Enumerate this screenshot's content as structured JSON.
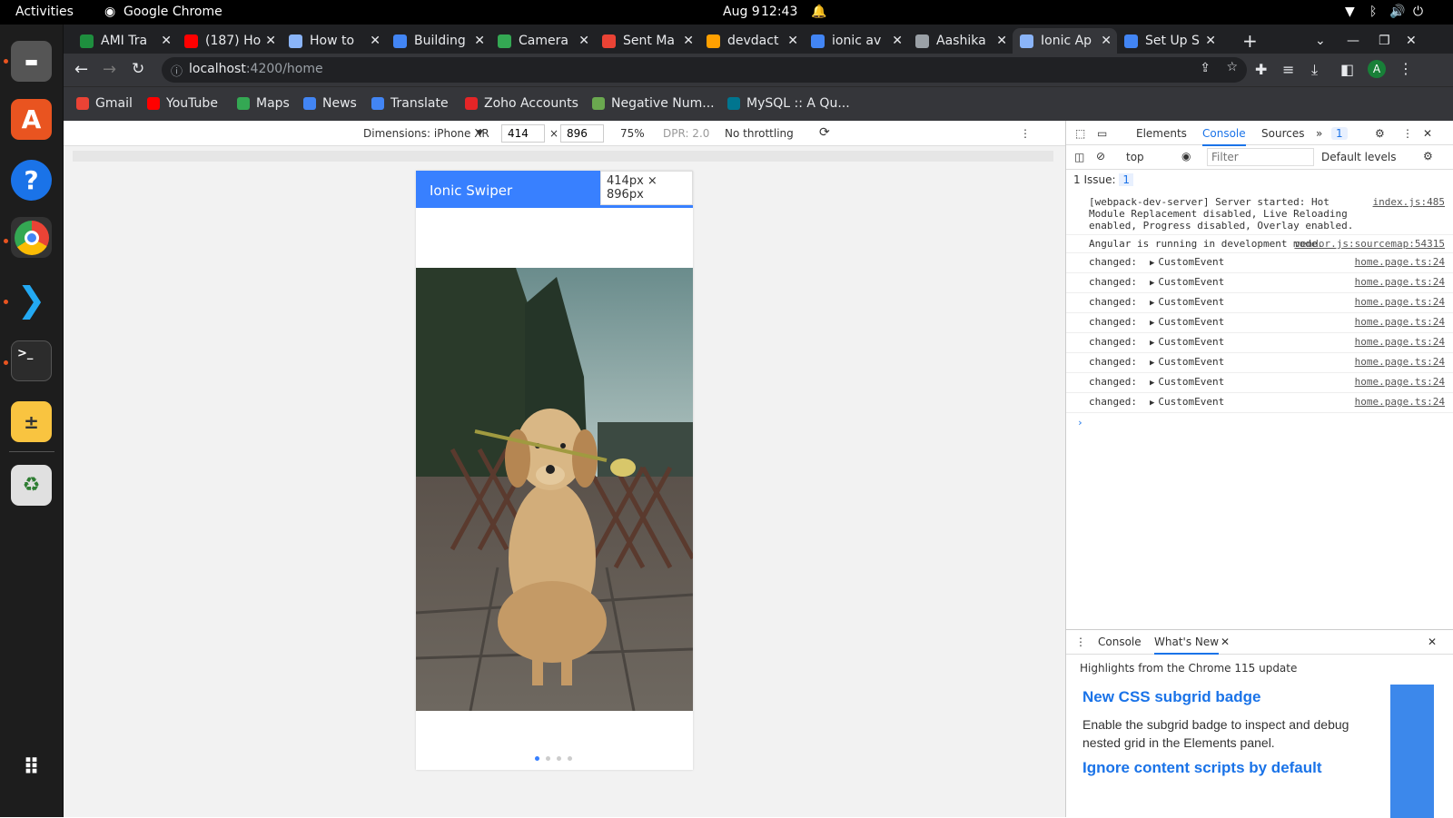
{
  "system": {
    "activities": "Activities",
    "app_name": "Google Chrome",
    "date": "Aug 9",
    "time": "12:43"
  },
  "tabs": [
    {
      "label": "AMI Tra",
      "color": "#1e8e3e"
    },
    {
      "label": "(187) Ho",
      "color": "#ff0000"
    },
    {
      "label": "How to",
      "color": "#8ab4f8"
    },
    {
      "label": "Building",
      "color": "#4285f4"
    },
    {
      "label": "Camera",
      "color": "#34a853"
    },
    {
      "label": "Sent Ma",
      "color": "#ea4335"
    },
    {
      "label": "devdact",
      "color": "#ffa000"
    },
    {
      "label": "ionic av",
      "color": "#4285f4"
    },
    {
      "label": "Aashika",
      "color": "#9aa0a6"
    },
    {
      "label": "Ionic Ap",
      "color": "#8ab4f8"
    },
    {
      "label": "Set Up S",
      "color": "#4285f4"
    }
  ],
  "url": {
    "host": "localhost",
    "path": ":4200/home"
  },
  "profile_initial": "A",
  "bookmarks": [
    {
      "label": "Gmail",
      "color": "#ea4335"
    },
    {
      "label": "YouTube",
      "color": "#ff0000"
    },
    {
      "label": "Maps",
      "color": "#34a853"
    },
    {
      "label": "News",
      "color": "#4285f4"
    },
    {
      "label": "Translate",
      "color": "#4285f4"
    },
    {
      "label": "Zoho Accounts",
      "color": "#e42527"
    },
    {
      "label": "Negative Num...",
      "color": "#6aa84f"
    },
    {
      "label": "MySQL :: A Qu...",
      "color": "#00758f"
    }
  ],
  "device": {
    "dimensions": "Dimensions: iPhone XR",
    "width": "414",
    "height": "896",
    "zoom": "75%",
    "dpr": "DPR: 2.0",
    "throttling": "No throttling",
    "times": "×"
  },
  "app": {
    "title": "Ionic Swiper",
    "size_badge": "414px × 896px",
    "active_slide": 1,
    "slide_count": 4
  },
  "devtools": {
    "tabs": [
      "Elements",
      "Console",
      "Sources"
    ],
    "badge": "1",
    "context": "top",
    "filter_placeholder": "Filter",
    "levels": "Default levels",
    "issues": "1 Issue:",
    "issues_count": "1",
    "logs": [
      {
        "text": "[webpack-dev-server] Server started: Hot Module Replacement disabled, Live Reloading enabled, Progress disabled, Overlay enabled.",
        "src": "index.js:485"
      },
      {
        "text": "Angular is running in development mode.",
        "src": "vendor.js:sourcemap:54315"
      },
      {
        "label": "changed:",
        "obj": "CustomEvent",
        "src": "home.page.ts:24"
      },
      {
        "label": "changed:",
        "obj": "CustomEvent",
        "src": "home.page.ts:24"
      },
      {
        "label": "changed:",
        "obj": "CustomEvent",
        "src": "home.page.ts:24"
      },
      {
        "label": "changed:",
        "obj": "CustomEvent",
        "src": "home.page.ts:24"
      },
      {
        "label": "changed:",
        "obj": "CustomEvent",
        "src": "home.page.ts:24"
      },
      {
        "label": "changed:",
        "obj": "CustomEvent",
        "src": "home.page.ts:24"
      },
      {
        "label": "changed:",
        "obj": "CustomEvent",
        "src": "home.page.ts:24"
      },
      {
        "label": "changed:",
        "obj": "CustomEvent",
        "src": "home.page.ts:24"
      }
    ],
    "drawer": {
      "tabs": [
        "Console",
        "What's New"
      ],
      "highlights": "Highlights from the Chrome 115 update",
      "item1_title": "New CSS subgrid badge",
      "item1_desc": "Enable the subgrid badge to inspect and debug nested grid in the Elements panel.",
      "item2_title": "Ignore content scripts by default"
    }
  }
}
